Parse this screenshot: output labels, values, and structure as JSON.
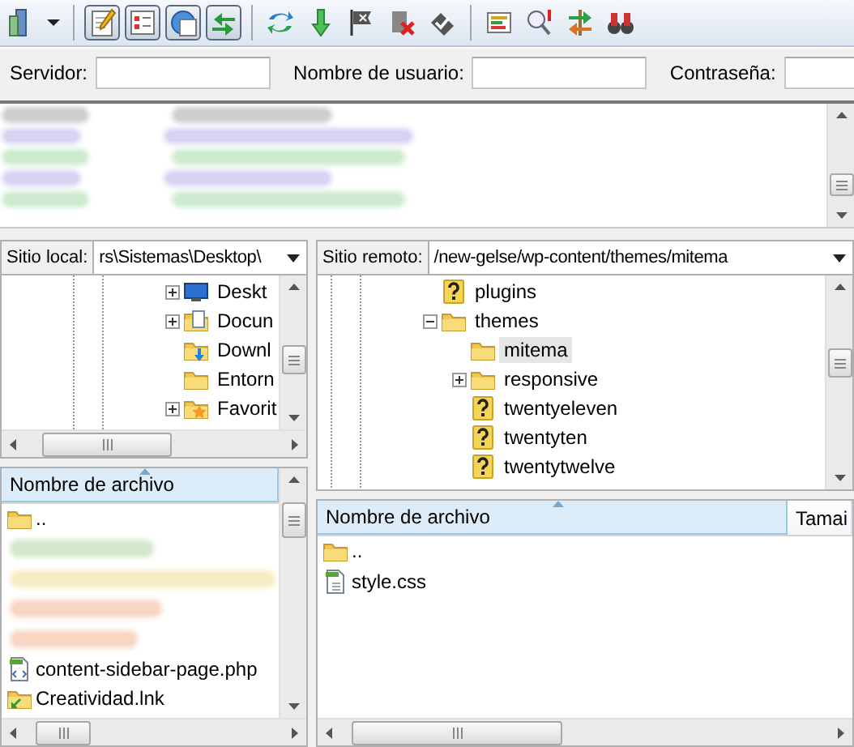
{
  "toolbar": [
    {
      "kind": "site-manager"
    },
    {
      "kind": "menu-caret"
    },
    {
      "kind": "separator"
    },
    {
      "kind": "log",
      "pressed": true
    },
    {
      "kind": "local-tree",
      "pressed": true
    },
    {
      "kind": "remote-tree",
      "pressed": true
    },
    {
      "kind": "queue",
      "pressed": true
    },
    {
      "kind": "separator"
    },
    {
      "kind": "refresh"
    },
    {
      "kind": "process-queue"
    },
    {
      "kind": "cancel"
    },
    {
      "kind": "disconnect"
    },
    {
      "kind": "reconnect"
    },
    {
      "kind": "separator"
    },
    {
      "kind": "filter"
    },
    {
      "kind": "compare"
    },
    {
      "kind": "sync-browse"
    },
    {
      "kind": "search"
    }
  ],
  "quickconnect": {
    "fields": [
      {
        "label": "Servidor:"
      },
      {
        "label": "Nombre de usuario:"
      },
      {
        "label": "Contraseña:"
      }
    ]
  },
  "log": {
    "lines": [
      {
        "color": "#cfcfcf"
      },
      {
        "color": "#d9d3f3"
      },
      {
        "color": "#cdeccf"
      },
      {
        "color": "#d9d3f3"
      },
      {
        "color": "#cdeccf"
      }
    ]
  },
  "local": {
    "site_label": "Sitio local:",
    "path": "rs\\Sistemas\\Desktop\\",
    "tree": [
      {
        "label": "Deskt",
        "kind": "desktop",
        "expanded": false,
        "selected": false
      },
      {
        "label": "Docun",
        "kind": "documents",
        "expanded": false,
        "selected": false
      },
      {
        "label": "Downl",
        "kind": "downloads",
        "selected": false
      },
      {
        "label": "Entorn",
        "kind": "folder",
        "selected": false
      },
      {
        "label": "Favorit",
        "kind": "favorites",
        "expanded": false,
        "selected": false
      }
    ],
    "files": {
      "columns": [
        "Nombre de archivo"
      ],
      "rows": [
        {
          "kind": "folder",
          "name": ".."
        },
        {
          "kind": "blurred",
          "color": "#d5e8cc"
        },
        {
          "kind": "blurred",
          "color": "#f7edc4"
        },
        {
          "kind": "blurred",
          "color": "#f7d6c4"
        },
        {
          "kind": "blurred",
          "color": "#f7d6c4"
        },
        {
          "kind": "php",
          "name": "content-sidebar-page.php"
        },
        {
          "kind": "shortcut",
          "name": "Creatividad.lnk"
        }
      ]
    }
  },
  "remote": {
    "site_label": "Sitio remoto:",
    "path": "/new-gelse/wp-content/themes/mitema",
    "tree": [
      {
        "label": "plugins",
        "kind": "unknown",
        "selected": false
      },
      {
        "label": "themes",
        "kind": "folder",
        "expanded": true,
        "selected": false,
        "children": [
          {
            "label": "mitema",
            "kind": "folder",
            "selected": true
          },
          {
            "label": "responsive",
            "kind": "folder",
            "expanded": false,
            "selected": false
          },
          {
            "label": "twentyeleven",
            "kind": "unknown",
            "selected": false
          },
          {
            "label": "twentyten",
            "kind": "unknown",
            "selected": false
          },
          {
            "label": "twentytwelve",
            "kind": "unknown",
            "selected": false
          }
        ]
      }
    ],
    "files": {
      "columns": [
        "Nombre de archivo",
        "Tamai"
      ],
      "rows": [
        {
          "kind": "folder",
          "name": ".."
        },
        {
          "kind": "css",
          "name": "style.css"
        }
      ]
    }
  }
}
